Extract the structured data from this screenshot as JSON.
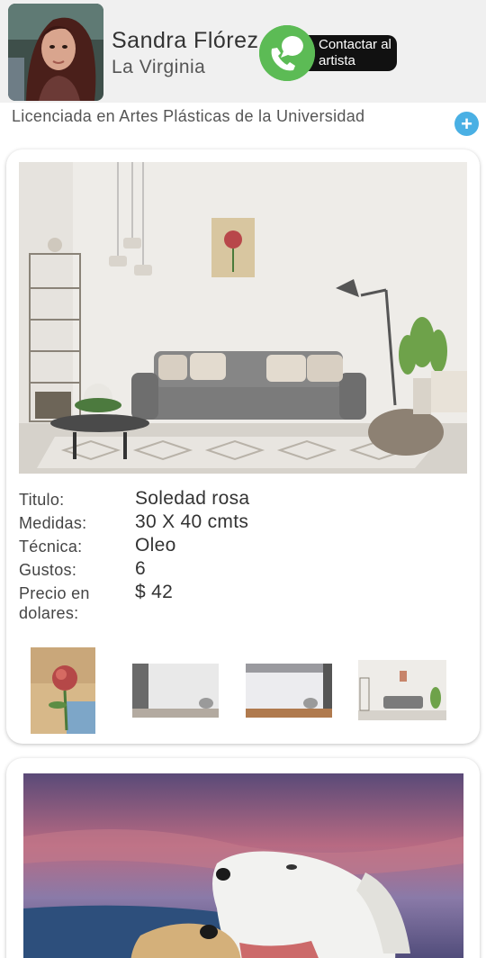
{
  "artist": {
    "name": "Sandra Flórez",
    "city": "La Virginia",
    "bio": "Licenciada en Artes Plásticas de la Universidad",
    "contact_label": "Contactar al artista"
  },
  "expand_label": "+",
  "artwork": {
    "fields": [
      {
        "label": "Titulo:",
        "value": "Soledad rosa"
      },
      {
        "label": "Medidas:",
        "value": "30 X 40 cmts"
      },
      {
        "label": "Técnica:",
        "value": "Oleo"
      },
      {
        "label": "Gustos:",
        "value": "6"
      },
      {
        "label": "Precio en dolares:",
        "value": "$ 42"
      }
    ]
  },
  "colors": {
    "whatsapp_green": "#5cbb55",
    "accent_blue": "#4ab0e4",
    "header_bg": "#f0f0f0"
  }
}
